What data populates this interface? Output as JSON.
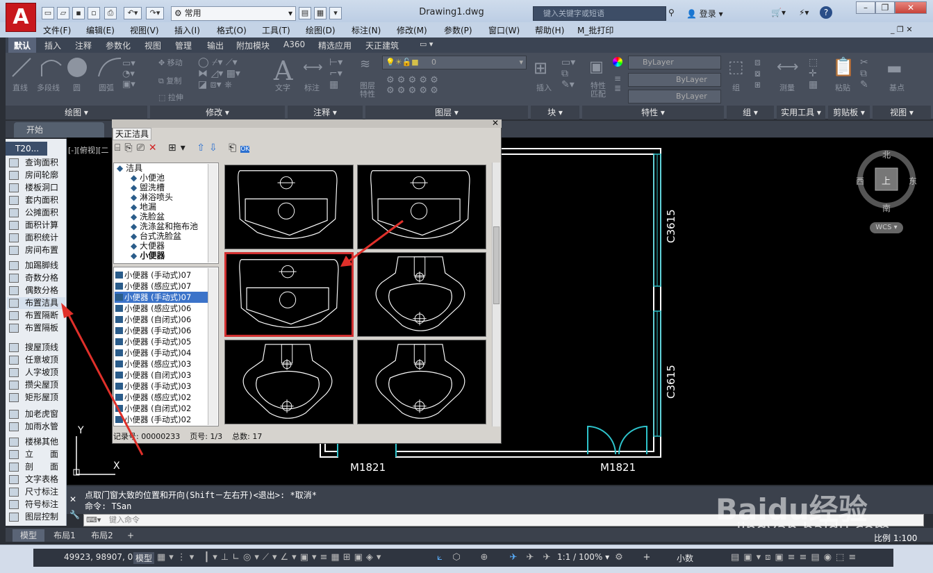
{
  "app": {
    "logo_letter": "A",
    "doc_title": "Drawing1.dwg",
    "workspace": "常用",
    "search_placeholder": "键入关键字或短语",
    "login": "登录",
    "help": "?"
  },
  "menus": [
    "文件(F)",
    "编辑(E)",
    "视图(V)",
    "插入(I)",
    "格式(O)",
    "工具(T)",
    "绘图(D)",
    "标注(N)",
    "修改(M)",
    "参数(P)",
    "窗口(W)",
    "帮助(H)",
    "M_批打印"
  ],
  "ribbon_tabs": [
    "默认",
    "插入",
    "注释",
    "参数化",
    "视图",
    "管理",
    "输出",
    "附加模块",
    "A360",
    "精选应用",
    "天正建筑"
  ],
  "ribbon_tools": {
    "line": "直线",
    "pline": "多段线",
    "circle": "圆",
    "arc": "圆弧",
    "move": "移动",
    "rotate": "旋转",
    "copy": "复制",
    "mirror": "镜像",
    "stretch": "拉伸",
    "scale": "缩放",
    "text": "文字",
    "dim": "标注",
    "layer_props": "图层\n特性",
    "insert": "插入",
    "match": "特性\n匹配",
    "group": "组",
    "measure": "测量",
    "paste": "粘贴",
    "base": "基点",
    "layer_value": "0",
    "bylayer": "ByLayer"
  },
  "ribbon_panels": [
    "绘图",
    "修改",
    "注释",
    "图层",
    "块",
    "特性",
    "组",
    "实用工具",
    "剪贴板",
    "视图"
  ],
  "file_tabs": {
    "start": "开始"
  },
  "viewport_label": "[-][俯视][二",
  "palette": {
    "title": "T20...",
    "items": [
      "查询面积",
      "房间轮廓",
      "楼板洞口",
      "套内面积",
      "公摊面积",
      "面积计算",
      "面积统计",
      "房间布置",
      "加踢脚线",
      "奇数分格",
      "偶数分格",
      "布置洁具",
      "布置隔断",
      "布置隔板",
      "搜屋顶线",
      "任意坡顶",
      "人字坡顶",
      "攒尖屋顶",
      "矩形屋顶",
      "加老虎窗",
      "加雨水管",
      "楼梯其他",
      "立　　面",
      "剖　　面",
      "文字表格",
      "尺寸标注",
      "符号标注",
      "图层控制"
    ]
  },
  "dialog": {
    "title": "天正洁具",
    "tree_root": "洁具",
    "tree_items": [
      "小便池",
      "盥洗槽",
      "淋浴喷头",
      "地漏",
      "洗脸盆",
      "洗涤盆和拖布池",
      "台式洗脸盆",
      "大便器",
      "小便器"
    ],
    "list_items": [
      "小便器 (手动式)07",
      "小便器 (感应式)07",
      "小便器 (手动式)07",
      "小便器 (感应式)06",
      "小便器 (自闭式)06",
      "小便器 (手动式)06",
      "小便器 (手动式)05",
      "小便器 (手动式)04",
      "小便器 (感应式)03",
      "小便器 (自闭式)03",
      "小便器 (手动式)03",
      "小便器 (感应式)02",
      "小便器 (自闭式)02",
      "小便器 (手动式)02"
    ],
    "selected_list_index": 2,
    "selected_thumb_index": 2,
    "status": {
      "record_label": "记录号:",
      "record": "00000233",
      "page_label": "页号:",
      "page": "1/3",
      "total_label": "总数:",
      "total": "17"
    }
  },
  "drawing": {
    "windows": [
      "C3615",
      "C3615"
    ],
    "doors": [
      "M1821",
      "M1821"
    ],
    "y_axis": "Y",
    "x_axis": "X"
  },
  "viewcube": {
    "north": "北",
    "south": "南",
    "east": "东",
    "west": "西",
    "top": "上",
    "wcs": "WCS"
  },
  "command": {
    "line1": "点取门窗大致的位置和开向(Shift－左右开)<退出>: *取消*",
    "line2": "命令: TSan",
    "placeholder": "键入命令"
  },
  "layout_tabs": [
    "模型",
    "布局1",
    "布局2"
  ],
  "statusbar": {
    "coords": "49923, 98907, 0",
    "model": "模型",
    "scale": "1:1 / 100%",
    "units": "小数",
    "annotation_scale": "比例 1:100"
  },
  "watermark": {
    "line1": "Baidu经验",
    "line2": "jingyan.baidu.com"
  },
  "colors": {
    "accent_red": "#d03030",
    "canvas": "#000000",
    "wall": "#ffffff",
    "window": "#2ec4cc"
  }
}
